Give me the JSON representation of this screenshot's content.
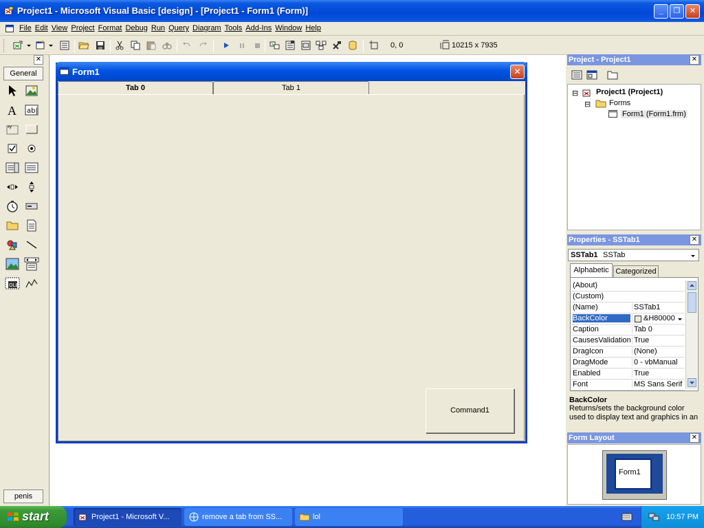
{
  "window": {
    "title": "Project1 - Microsoft Visual Basic [design] - [Project1 - Form1 (Form)]",
    "minimize_label": "_",
    "restore_label": "❐",
    "close_label": "✕"
  },
  "menubar": {
    "items": [
      {
        "label": "File"
      },
      {
        "label": "Edit"
      },
      {
        "label": "View"
      },
      {
        "label": "Project"
      },
      {
        "label": "Format"
      },
      {
        "label": "Debug"
      },
      {
        "label": "Run"
      },
      {
        "label": "Query"
      },
      {
        "label": "Diagram"
      },
      {
        "label": "Tools"
      },
      {
        "label": "Add-Ins"
      },
      {
        "label": "Window"
      },
      {
        "label": "Help"
      }
    ],
    "mdi_min": "_",
    "mdi_restore": "❐",
    "mdi_close": "✕"
  },
  "toolbar": {
    "position": "0, 0",
    "size": "10215 x 7935"
  },
  "toolbox": {
    "tab_general": "General",
    "tab_bottom": "penis",
    "close": "✕"
  },
  "form": {
    "title": "Form1",
    "close": "✕",
    "tabs": [
      {
        "label": "Tab 0",
        "active": true
      },
      {
        "label": "Tab 1",
        "active": false
      }
    ],
    "command_button": "Command1"
  },
  "project_panel": {
    "title": "Project - Project1",
    "close": "✕",
    "tree": {
      "project": "Project1 (Project1)",
      "folder": "Forms",
      "form": "Form1 (Form1.frm)"
    }
  },
  "properties_panel": {
    "title": "Properties - SSTab1",
    "close": "✕",
    "object_name": "SSTab1",
    "object_type": "SSTab",
    "tabs": [
      "Alphabetic",
      "Categorized"
    ],
    "rows": [
      {
        "key": "(About)",
        "value": ""
      },
      {
        "key": "(Custom)",
        "value": ""
      },
      {
        "key": "(Name)",
        "value": "SSTab1"
      },
      {
        "key": "BackColor",
        "value": "&H80000",
        "selected": true
      },
      {
        "key": "Caption",
        "value": "Tab 0"
      },
      {
        "key": "CausesValidation",
        "value": "True"
      },
      {
        "key": "DragIcon",
        "value": "(None)"
      },
      {
        "key": "DragMode",
        "value": "0 - vbManual"
      },
      {
        "key": "Enabled",
        "value": "True"
      },
      {
        "key": "Font",
        "value": "MS Sans Serif"
      }
    ],
    "desc_title": "BackColor",
    "desc_text": "Returns/sets the background color used to display text and graphics in an"
  },
  "layout_panel": {
    "title": "Form Layout",
    "close": "✕",
    "form_label": "Form1"
  },
  "taskbar": {
    "start": "start",
    "tasks": [
      {
        "label": "Project1 - Microsoft V..."
      },
      {
        "label": "remove a tab from SS..."
      },
      {
        "label": "lol"
      }
    ],
    "clock": "10:57 PM"
  },
  "colors": {
    "titlebar": "#0054e3",
    "panel_title": "#7a96df",
    "selection": "#316ac5",
    "taskbar": "#245edc",
    "start": "#3c9a38"
  }
}
